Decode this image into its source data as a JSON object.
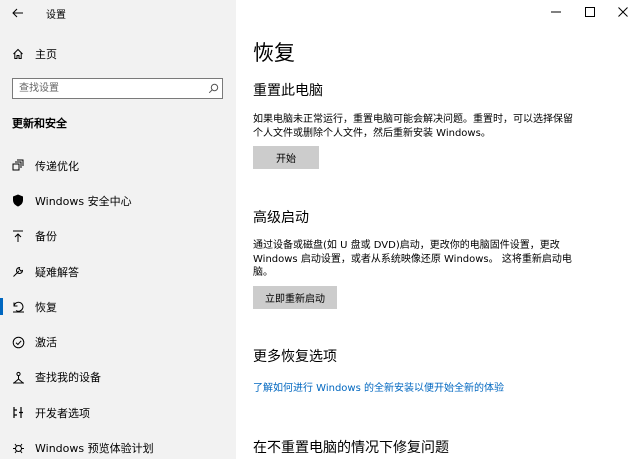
{
  "window": {
    "title": "设置"
  },
  "sidebar": {
    "home_label": "主页",
    "search_placeholder": "查找设置",
    "section_title": "更新和安全",
    "items": [
      {
        "label": "传递优化",
        "icon": "delivery-optimization-icon"
      },
      {
        "label": "Windows 安全中心",
        "icon": "shield-icon"
      },
      {
        "label": "备份",
        "icon": "backup-arrow-icon"
      },
      {
        "label": "疑难解答",
        "icon": "wrench-icon"
      },
      {
        "label": "恢复",
        "icon": "recovery-icon",
        "active": true
      },
      {
        "label": "激活",
        "icon": "activation-check-icon"
      },
      {
        "label": "查找我的设备",
        "icon": "find-device-icon"
      },
      {
        "label": "开发者选项",
        "icon": "developer-icon"
      },
      {
        "label": "Windows 预览体验计划",
        "icon": "insider-icon"
      }
    ]
  },
  "main": {
    "title": "恢复",
    "reset": {
      "heading": "重置此电脑",
      "line1": "如果电脑未正常运行，重置电脑可能会解决问题。重置时，可以选择保留",
      "line2": "个人文件或删除个人文件，然后重新安装 Windows。",
      "button": "开始"
    },
    "advanced": {
      "heading": "高级启动",
      "line1": "通过设备或磁盘(如 U 盘或 DVD)启动，更改你的电脑固件设置，更改",
      "line2": "Windows 启动设置，或者从系统映像还原 Windows。 这将重新启动电",
      "line3": "脑。",
      "button": "立即重新启动"
    },
    "more": {
      "heading": "更多恢复选项",
      "link": "了解如何进行 Windows 的全新安装以便开始全新的体验"
    },
    "fix": {
      "heading": "在不重置电脑的情况下修复问题"
    }
  },
  "colors": {
    "accent": "#0067c0",
    "sidebar_bg": "#f2f2f2",
    "button_bg": "#cccccc"
  }
}
